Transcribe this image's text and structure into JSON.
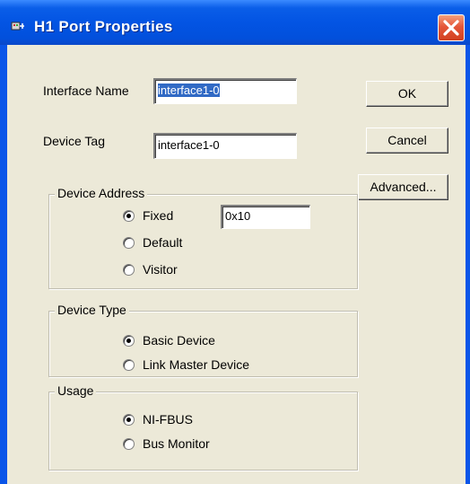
{
  "window": {
    "title": "H1 Port Properties",
    "icon": "network-port-icon",
    "colors": {
      "titlebar": "#0354e3",
      "client": "#ece9d8",
      "close": "#e4573a"
    }
  },
  "fields": {
    "interface_name_label": "Interface Name",
    "interface_name_value": "interface1-0",
    "device_tag_label": "Device Tag",
    "device_tag_value": "interface1-0"
  },
  "buttons": {
    "ok": "OK",
    "cancel": "Cancel",
    "advanced": "Advanced..."
  },
  "device_address": {
    "title": "Device Address",
    "options": [
      {
        "label": "Fixed",
        "selected": true
      },
      {
        "label": "Default",
        "selected": false
      },
      {
        "label": "Visitor",
        "selected": false
      }
    ],
    "fixed_value": "0x10"
  },
  "device_type": {
    "title": "Device Type",
    "options": [
      {
        "label": "Basic Device",
        "selected": true
      },
      {
        "label": "Link Master Device",
        "selected": false
      }
    ]
  },
  "usage": {
    "title": "Usage",
    "options": [
      {
        "label": "NI-FBUS",
        "selected": true
      },
      {
        "label": "Bus Monitor",
        "selected": false
      }
    ]
  }
}
